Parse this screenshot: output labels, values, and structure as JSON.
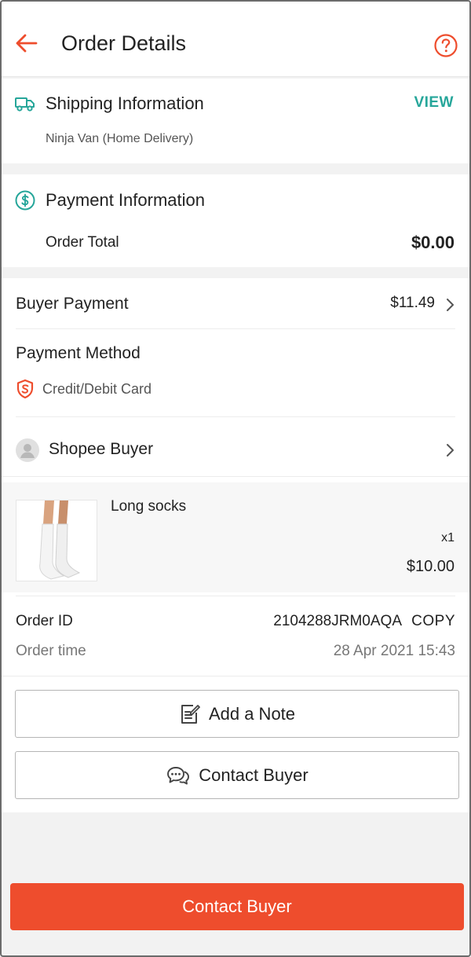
{
  "header": {
    "title": "Order Details",
    "back_icon": "back-arrow-icon",
    "help_icon": "help-icon"
  },
  "shipping": {
    "title": "Shipping Information",
    "view_label": "VIEW",
    "carrier": "Ninja Van (Home Delivery)",
    "icon": "truck-icon"
  },
  "payment": {
    "title": "Payment Information",
    "order_total_label": "Order Total",
    "order_total_value": "$0.00",
    "icon": "dollar-coin-icon"
  },
  "buyer_payment": {
    "label": "Buyer Payment",
    "value": "$11.49"
  },
  "payment_method": {
    "label": "Payment Method",
    "value": "Credit/Debit Card",
    "icon": "shield-icon"
  },
  "buyer": {
    "name": "Shopee Buyer",
    "icon": "avatar-icon"
  },
  "product": {
    "name": "Long socks",
    "quantity": "x1",
    "price": "$10.00"
  },
  "order": {
    "id_label": "Order ID",
    "id_value": "2104288JRM0AQA",
    "copy_label": "COPY",
    "time_label": "Order time",
    "time_value": "28 Apr 2021 15:43"
  },
  "actions": {
    "add_note": "Add a Note",
    "contact_buyer": "Contact Buyer",
    "primary_contact_buyer": "Contact Buyer"
  },
  "colors": {
    "accent": "#ee4d2d",
    "teal": "#26a69a",
    "background": "#f2f2f2"
  }
}
